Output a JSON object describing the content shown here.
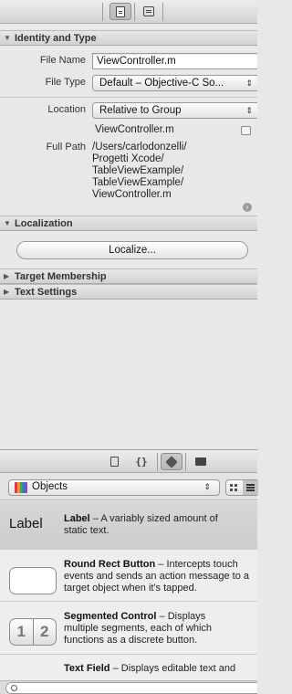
{
  "inspector_toolbar": {
    "tabs": [
      {
        "icon": "file-inspector-icon",
        "selected": true
      },
      {
        "icon": "quick-help-icon",
        "selected": false
      }
    ]
  },
  "identity": {
    "header": "Identity and Type",
    "file_name_label": "File Name",
    "file_name_value": "ViewController.m",
    "file_type_label": "File Type",
    "file_type_value": "Default – Objective-C So...",
    "location_label": "Location",
    "location_value": "Relative to Group",
    "location_file": "ViewController.m",
    "full_path_label": "Full Path",
    "full_path_lines": [
      "/Users/carlodonzelli/",
      "Progetti Xcode/",
      "TableViewExample/",
      "TableViewExample/",
      "ViewController.m"
    ]
  },
  "localization": {
    "header": "Localization",
    "localize_button": "Localize..."
  },
  "collapsed_sections": [
    "Target Membership",
    "Text Settings"
  ],
  "library_toolbar": {
    "tabs": [
      {
        "icon": "file-template-icon",
        "selected": false
      },
      {
        "icon": "code-snippet-icon",
        "selected": false
      },
      {
        "icon": "object-library-icon",
        "selected": true
      },
      {
        "icon": "media-library-icon",
        "selected": false
      }
    ]
  },
  "library_filter": {
    "selected": "Objects"
  },
  "library_items": [
    {
      "thumb_text": "Label",
      "name": "Label",
      "description": " – A variably sized amount of static text.",
      "lines": [
        "– A variably sized amount of",
        "static text."
      ]
    },
    {
      "name": "Round Rect Button",
      "lines": [
        "– Intercepts touch",
        "events and sends an action message to a",
        "target object when it's tapped."
      ]
    },
    {
      "thumb_segments": [
        "1",
        "2"
      ],
      "name": "Segmented Control",
      "lines": [
        "– Displays",
        "multiple segments, each of which",
        "functions as a discrete button."
      ]
    },
    {
      "name": "Text Field",
      "lines": [
        "– Displays editable text and"
      ]
    }
  ],
  "colors": {
    "selected_item_bg": "#d0d0d0",
    "panel_bg": "#e8e8e8",
    "header_text": "#333333"
  }
}
